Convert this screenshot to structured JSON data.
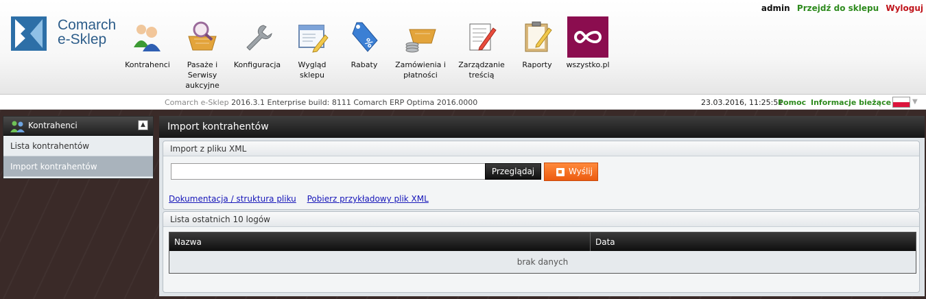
{
  "topbar": {
    "user": "admin",
    "go_to_shop": "Przejdź do sklepu",
    "logout": "Wyloguj"
  },
  "logo": {
    "line1": "Comarch",
    "line2": "e-Sklep"
  },
  "nav": [
    {
      "label": "Kontrahenci",
      "icon": "users-icon"
    },
    {
      "label": "Pasaże i Serwisy aukcyjne",
      "icon": "basket-magnifier-icon"
    },
    {
      "label": "Konfiguracja",
      "icon": "wrench-icon"
    },
    {
      "label": "Wygląd sklepu",
      "icon": "window-pencil-icon"
    },
    {
      "label": "Rabaty",
      "icon": "discount-tag-icon"
    },
    {
      "label": "Zamówienia i płatności",
      "icon": "basket-coins-icon"
    },
    {
      "label": "Zarządzanie treścią",
      "icon": "document-pencil-icon"
    },
    {
      "label": "Raporty",
      "icon": "clipboard-pencil-icon"
    },
    {
      "label": "wszystko.pl",
      "icon": "infinity-icon"
    }
  ],
  "infobar": {
    "product": "Comarch e-Sklep",
    "build": "2016.3.1 Enterprise build: 8111 Comarch ERP Optima 2016.0000",
    "datetime": "23.03.2016, 11:25:51",
    "help": "Pomoc",
    "news": "Informacje bieżące"
  },
  "sidebar": {
    "title": "Kontrahenci",
    "items": [
      {
        "label": "Lista kontrahentów"
      },
      {
        "label": "Import kontrahentów"
      }
    ]
  },
  "main": {
    "title": "Import kontrahentów",
    "import_box": {
      "title": "Import z pliku XML",
      "file_value": "",
      "browse_label": "Przeglądaj",
      "send_label": "Wyślij",
      "doc_link": "Dokumentacja / struktura pliku",
      "sample_link": "Pobierz przykładowy plik XML"
    },
    "logs_box": {
      "title": "Lista ostatnich 10 logów",
      "columns": [
        "Nazwa",
        "Data"
      ],
      "empty_text": "brak danych"
    }
  },
  "colors": {
    "accent_green": "#2e8b1e",
    "logout_red": "#c0141b",
    "send_orange": "#f0822e",
    "brand_blue": "#2d5d8a",
    "wszystko_purple": "#8b0d4f"
  }
}
